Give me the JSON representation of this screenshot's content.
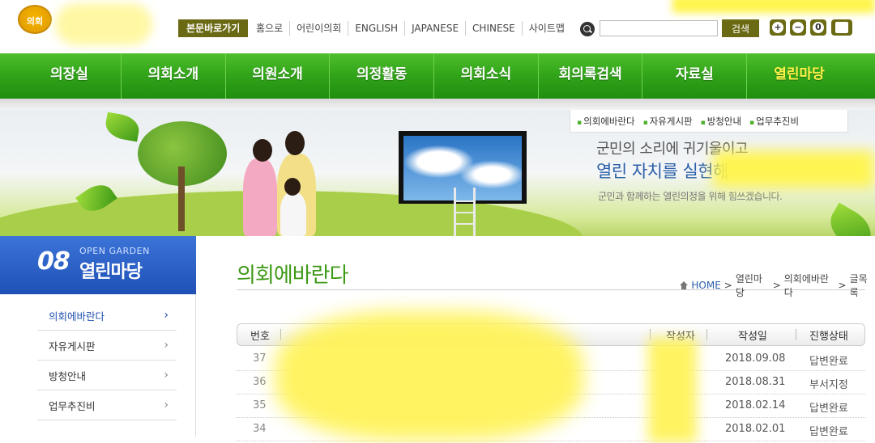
{
  "header": {
    "logo_text": "의회",
    "skip_label": "본문바로가기",
    "util_links": [
      "홈으로",
      "어린이의회",
      "ENGLISH",
      "JAPANESE",
      "CHINESE",
      "사이트맵"
    ],
    "search_placeholder": "",
    "search_button": "검색",
    "tools": [
      "+",
      "−",
      "0"
    ]
  },
  "gnb": {
    "items": [
      "의장실",
      "의회소개",
      "의원소개",
      "의정활동",
      "의회소식",
      "회의록검색",
      "자료실",
      "열린마당"
    ],
    "active_index": 7,
    "active_color": "#fff34a"
  },
  "sub_nav": [
    "의회에바란다",
    "자유게시판",
    "방청안내",
    "업무추진비"
  ],
  "banner": {
    "line1": "군민의 소리에 귀기울이고",
    "line2": "열린 자치를 실현해",
    "line3": "군민과 함께하는 열린의정을 위해 힘쓰겠습니다."
  },
  "lnb": {
    "number": "08",
    "english": "OPEN GARDEN",
    "title": "열린마당",
    "items": [
      {
        "label": "의회에바란다",
        "active": true
      },
      {
        "label": "자유게시판",
        "active": false
      },
      {
        "label": "방청안내",
        "active": false
      },
      {
        "label": "업무추진비",
        "active": false
      }
    ]
  },
  "content": {
    "title": "의회에바란다",
    "breadcrumb": [
      "HOME",
      "열린마당",
      "의회에바란다",
      "글목록"
    ],
    "columns": [
      "번호",
      "작성자",
      "작성일",
      "진행상태"
    ],
    "rows": [
      {
        "num": "37",
        "date": "2018.09.08",
        "status": "답변완료"
      },
      {
        "num": "36",
        "date": "2018.08.31",
        "status": "부서지정"
      },
      {
        "num": "35",
        "date": "2018.02.14",
        "status": "답변완료"
      },
      {
        "num": "34",
        "date": "2018.02.01",
        "status": "답변완료"
      }
    ]
  },
  "colors": {
    "nav_green": "#33a51a",
    "title_green": "#3e9a17",
    "lnb_blue": "#1f50b6",
    "button_olive": "#6b6a14"
  }
}
